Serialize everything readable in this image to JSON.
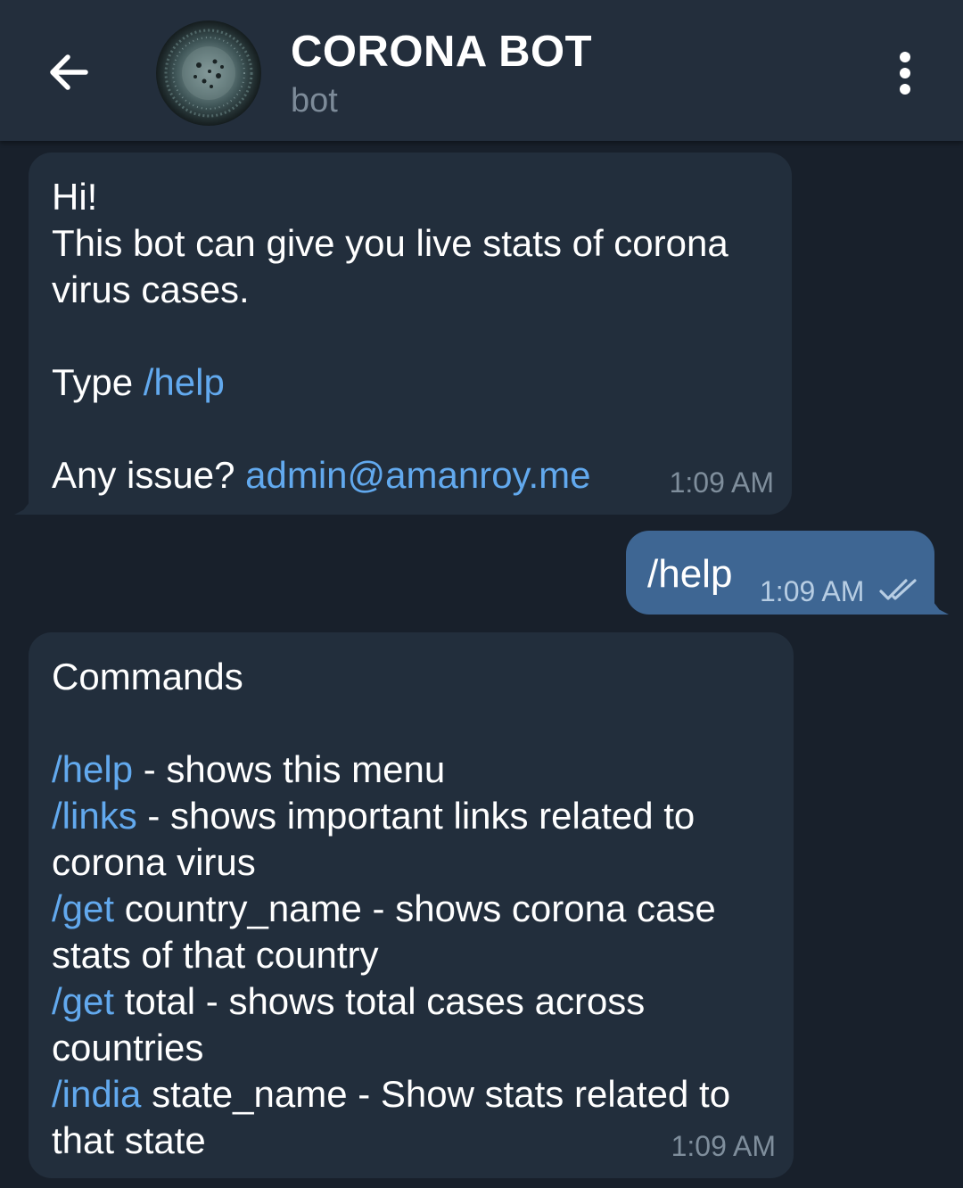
{
  "header": {
    "back_icon": "arrow-left-icon",
    "title": "CORONA BOT",
    "subtitle": "bot",
    "menu_icon": "more-vertical-icon"
  },
  "messages": [
    {
      "from": "bot",
      "greeting": "Hi!",
      "line1": "This bot can give you live stats of corona",
      "line2": "virus cases.",
      "type_prefix": "Type ",
      "type_cmd": "/help",
      "issue_prefix": "Any issue? ",
      "issue_email": "admin@amanroy.me",
      "time": "1:09 AM"
    },
    {
      "from": "me",
      "text": "/help",
      "time": "1:09 AM",
      "status_icon": "double-check-icon"
    },
    {
      "from": "bot",
      "heading": "Commands",
      "c1_cmd": "/help",
      "c1_text": " - shows this menu",
      "c2_cmd": "/links",
      "c2_text": " - shows important links related to",
      "c2_text2": "corona virus",
      "c3_cmd": "/get",
      "c3_text": " country_name - shows corona case",
      "c3_text2": "stats of that country",
      "c4_cmd": "/get",
      "c4_text": " total - shows total cases across",
      "c4_text2": "countries",
      "c5_cmd": "/india",
      "c5_text": " state_name - Show stats related to",
      "c5_text2": "that state",
      "time": "1:09 AM"
    }
  ],
  "colors": {
    "background": "#18202b",
    "header": "#232e3c",
    "incoming_bubble": "#222e3c",
    "outgoing_bubble": "#3e6693",
    "link": "#62a9ee",
    "meta_text": "#7f8e9c"
  }
}
